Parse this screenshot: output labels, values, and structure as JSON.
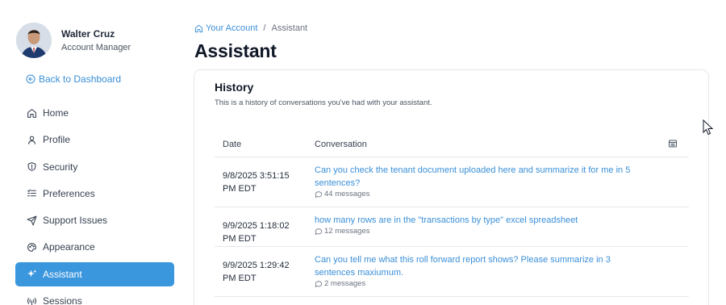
{
  "user": {
    "name": "Walter Cruz",
    "role": "Account Manager"
  },
  "sidebar": {
    "back_label": "Back to Dashboard",
    "items": [
      {
        "label": "Home",
        "icon": "home-icon",
        "active": false
      },
      {
        "label": "Profile",
        "icon": "user-icon",
        "active": false
      },
      {
        "label": "Security",
        "icon": "shield-icon",
        "active": false
      },
      {
        "label": "Preferences",
        "icon": "list-settings-icon",
        "active": false
      },
      {
        "label": "Support Issues",
        "icon": "send-icon",
        "active": false
      },
      {
        "label": "Appearance",
        "icon": "palette-icon",
        "active": false
      },
      {
        "label": "Assistant",
        "icon": "sparkles-icon",
        "active": true
      },
      {
        "label": "Sessions",
        "icon": "antenna-icon",
        "active": false
      }
    ]
  },
  "breadcrumb": {
    "root": "Your Account",
    "separator": "/",
    "current": "Assistant"
  },
  "page": {
    "title": "Assistant"
  },
  "history": {
    "title": "History",
    "subtitle": "This is a history of conversations you've had with your assistant.",
    "columns": {
      "date": "Date",
      "conversation": "Conversation"
    },
    "rows": [
      {
        "date_line1": "9/8/2025 3:51:15",
        "date_line2": "PM EDT",
        "conv_line1": "Can you check the tenant document uploaded here and summarize it for me in 5",
        "conv_line2": "sentences?",
        "messages": "44 messages"
      },
      {
        "date_line1": "9/9/2025 1:18:02",
        "date_line2": "PM EDT",
        "conv_line1": "how many rows are in the \"transactions by type\" excel spreadsheet",
        "conv_line2": "",
        "messages": "12 messages"
      },
      {
        "date_line1": "9/9/2025 1:29:42",
        "date_line2": "PM EDT",
        "conv_line1": "Can you tell me what this roll forward report shows? Please summarize in 3",
        "conv_line2": "sentences maxiumum.",
        "messages": "2 messages"
      }
    ]
  },
  "colors": {
    "accent": "#3a96dd",
    "link": "#3a8fd8",
    "border": "#e5e7eb"
  }
}
